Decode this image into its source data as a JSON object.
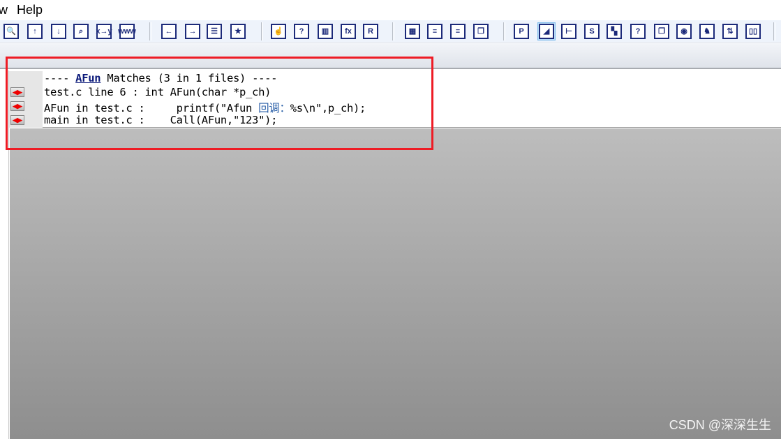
{
  "menu": {
    "items": [
      "w",
      "Help"
    ]
  },
  "toolbar": {
    "groups": [
      [
        "search-icon",
        "find-prev-icon",
        "find-next-icon",
        "find-files-icon",
        "replace-icon",
        "web-search-icon"
      ],
      [
        "jump-back-icon",
        "jump-forward-icon",
        "bookmark-list-icon",
        "bookmark-icon"
      ],
      [
        "symbol-window-icon",
        "help-icon",
        "reference-icon",
        "function-icon",
        "relation-icon"
      ],
      [
        "layout-1-icon",
        "layout-2-icon",
        "layout-3-icon",
        "windows-icon"
      ],
      [
        "project-icon",
        "full-view-icon",
        "tree-icon",
        "source-icon",
        "hierarchy-icon",
        "context-help-icon",
        "window-list-icon",
        "browser-icon",
        "bird-icon",
        "sync-icon",
        "compare-icon"
      ]
    ]
  },
  "results": {
    "header_prefix": "---- ",
    "header_keyword": "AFun",
    "header_suffix": " Matches (3 in 1 files) ----",
    "rows": [
      {
        "text": "test.c line 6 : int AFun(char *p_ch)"
      },
      {
        "text_a": "AFun in test.c :     printf(\"Afun ",
        "text_cn": "回调：",
        "text_b": "%s\\n\",p_ch);"
      },
      {
        "text": "main in test.c :    Call(AFun,\"123\");"
      }
    ]
  },
  "watermark": "CSDN @深深生生",
  "colors": {
    "highlight_box": "#ee1c25",
    "keyword": "#0b1a7a"
  }
}
